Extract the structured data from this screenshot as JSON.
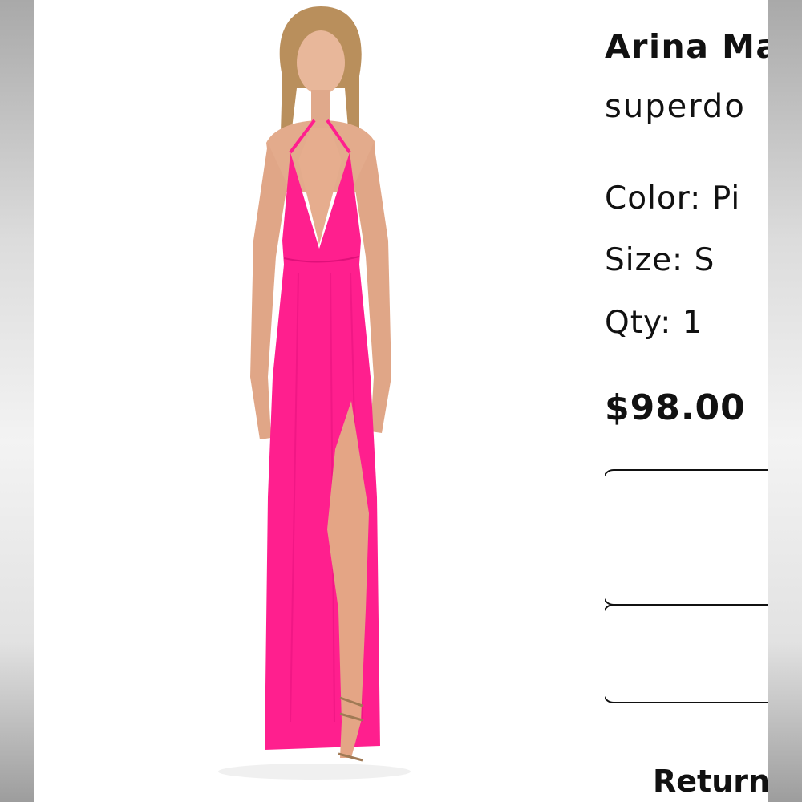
{
  "product": {
    "name": "Arina Ma",
    "brand": "superdo",
    "color_label": "Color:",
    "color_value": "Pi",
    "size_label": "Size:",
    "size_value": "S",
    "qty_label": "Qty:",
    "qty_value": "1",
    "price": "$98.00"
  },
  "returns_label": "Return",
  "colors": {
    "dress": "#ff1f8e",
    "text": "#111111"
  },
  "icons": [
    "model-photo"
  ]
}
